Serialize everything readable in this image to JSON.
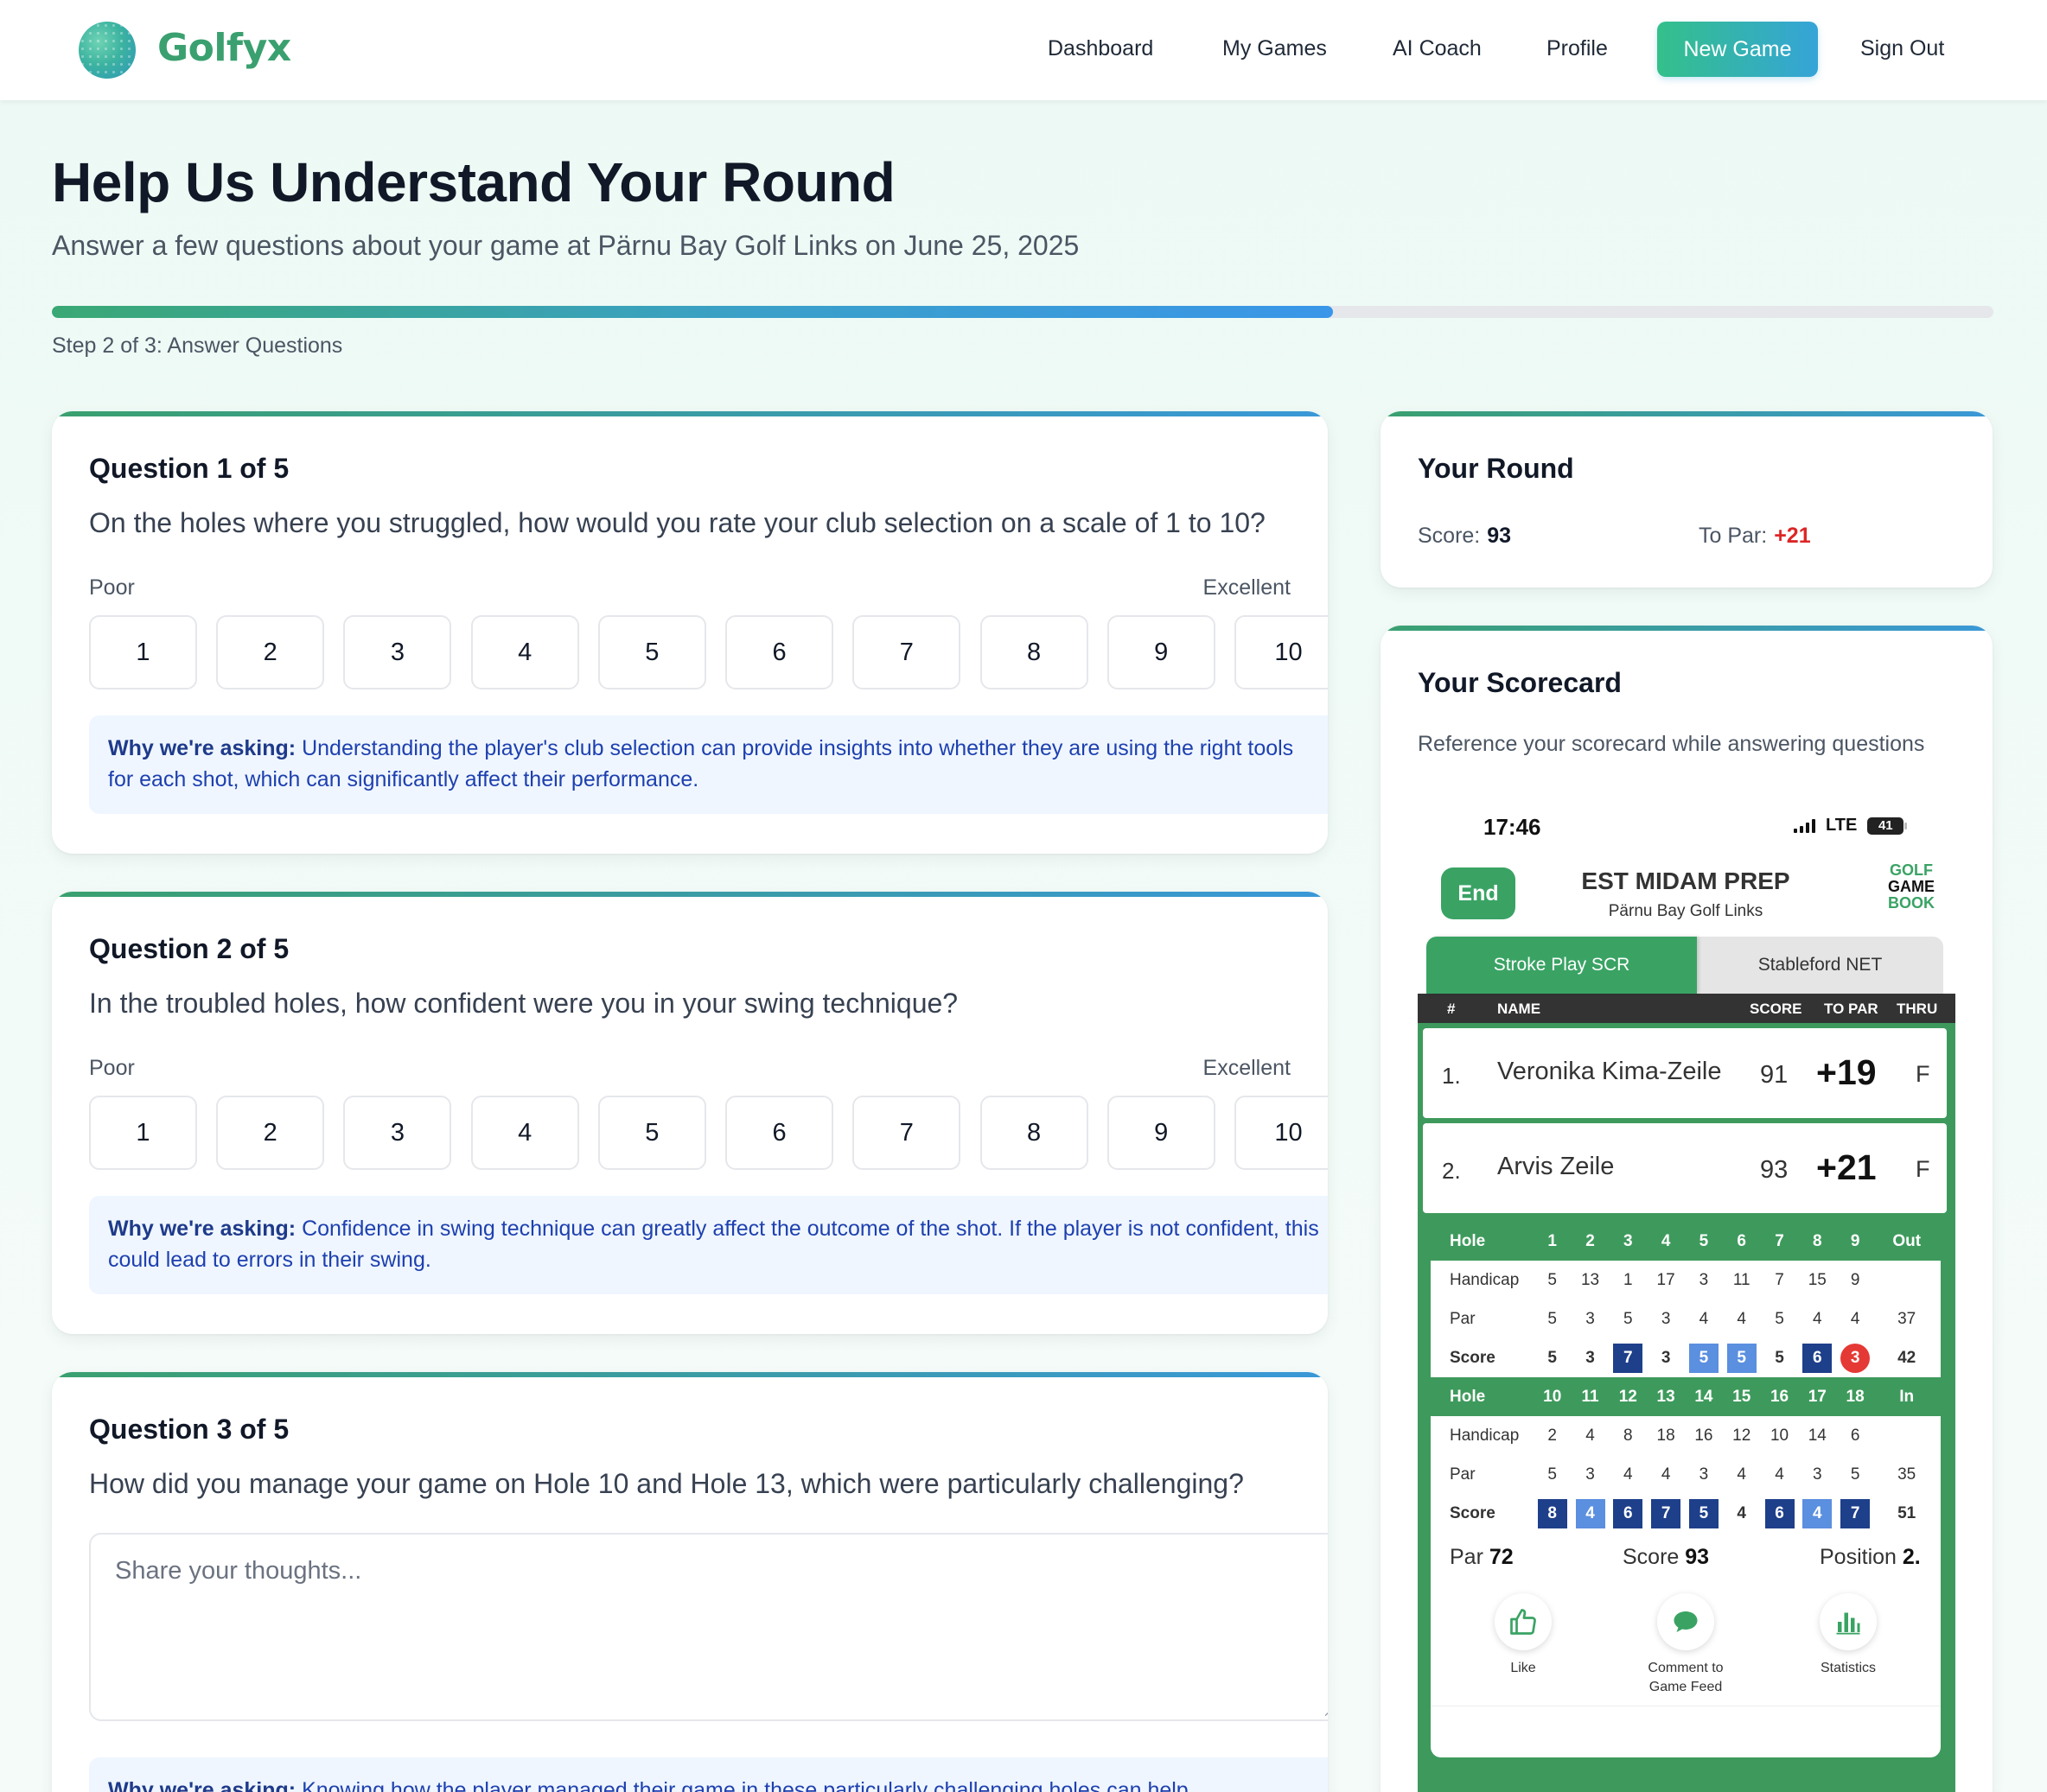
{
  "header": {
    "brand": "Golfyx",
    "nav": [
      "Dashboard",
      "My Games",
      "AI Coach",
      "Profile"
    ],
    "new_game": "New Game",
    "sign_out": "Sign Out"
  },
  "page": {
    "title": "Help Us Understand Your Round",
    "subtitle": "Answer a few questions about your game at Pärnu Bay Golf Links on June 25, 2025",
    "progress_fraction": 0.66,
    "step_label": "Step 2 of 3: Answer Questions"
  },
  "questions": [
    {
      "title": "Question 1 of 5",
      "text": "On the holes where you struggled, how would you rate your club selection on a scale of 1 to 10?",
      "low": "Poor",
      "high": "Excellent",
      "options": [
        "1",
        "2",
        "3",
        "4",
        "5",
        "6",
        "7",
        "8",
        "9",
        "10"
      ],
      "why_label": "Why we're asking:",
      "why_text": "Understanding the player's club selection can provide insights into whether they are using the right tools for each shot, which can significantly affect their performance."
    },
    {
      "title": "Question 2 of 5",
      "text": "In the troubled holes, how confident were you in your swing technique?",
      "low": "Poor",
      "high": "Excellent",
      "options": [
        "1",
        "2",
        "3",
        "4",
        "5",
        "6",
        "7",
        "8",
        "9",
        "10"
      ],
      "why_label": "Why we're asking:",
      "why_text": "Confidence in swing technique can greatly affect the outcome of the shot. If the player is not confident, this could lead to errors in their swing."
    },
    {
      "title": "Question 3 of 5",
      "text": "How did you manage your game on Hole 10 and Hole 13, which were particularly challenging?",
      "placeholder": "Share your thoughts...",
      "why_label": "Why we're asking:",
      "why_text": "Knowing how the player managed their game in these particularly challenging holes can help"
    }
  ],
  "round": {
    "title": "Your Round",
    "score_label": "Score:",
    "score": "93",
    "to_par_label": "To Par:",
    "to_par": "+21",
    "to_par_color": "#dc2626"
  },
  "scorecard": {
    "title": "Your Scorecard",
    "desc": "Reference your scorecard while answering questions",
    "status_time": "17:46",
    "status_network": "LTE",
    "battery": "41",
    "end_button": "End",
    "event_title": "EST MIDAM PREP",
    "event_course": "Pärnu Bay Golf Links",
    "logo_lines": [
      "GOLF",
      "GAME",
      "BOOK"
    ],
    "tabs": [
      "Stroke Play SCR",
      "Stableford NET"
    ],
    "columns": [
      "#",
      "NAME",
      "SCORE",
      "TO PAR",
      "THRU"
    ],
    "players": [
      {
        "pos": "1.",
        "name": "Veronika Kima-Zeile",
        "score": "91",
        "to_par": "+19",
        "thru": "F"
      },
      {
        "pos": "2.",
        "name": "Arvis Zeile",
        "score": "93",
        "to_par": "+21",
        "thru": "F"
      }
    ],
    "front": {
      "hole_label": "Hole",
      "holes": [
        "1",
        "2",
        "3",
        "4",
        "5",
        "6",
        "7",
        "8",
        "9"
      ],
      "total_label": "Out",
      "handicap_label": "Handicap",
      "handicap": [
        "5",
        "13",
        "1",
        "17",
        "3",
        "11",
        "7",
        "15",
        "9"
      ],
      "par_label": "Par",
      "par": [
        "5",
        "3",
        "5",
        "3",
        "4",
        "4",
        "5",
        "4",
        "4"
      ],
      "par_total": "37",
      "score_label": "Score",
      "score": [
        "5",
        "3",
        "7",
        "3",
        "5",
        "5",
        "5",
        "6",
        "3"
      ],
      "score_style": [
        "",
        "",
        "dark",
        "",
        "light",
        "light",
        "",
        "dark",
        "red"
      ],
      "score_total": "42"
    },
    "back": {
      "hole_label": "Hole",
      "holes": [
        "10",
        "11",
        "12",
        "13",
        "14",
        "15",
        "16",
        "17",
        "18"
      ],
      "total_label": "In",
      "handicap_label": "Handicap",
      "handicap": [
        "2",
        "4",
        "8",
        "18",
        "16",
        "12",
        "10",
        "14",
        "6"
      ],
      "par_label": "Par",
      "par": [
        "5",
        "3",
        "4",
        "4",
        "3",
        "4",
        "4",
        "3",
        "5"
      ],
      "par_total": "35",
      "score_label": "Score",
      "score": [
        "8",
        "4",
        "6",
        "7",
        "5",
        "4",
        "6",
        "4",
        "7"
      ],
      "score_style": [
        "dark",
        "light",
        "dark",
        "dark",
        "dark",
        "",
        "dark",
        "light",
        "dark"
      ],
      "score_total": "51"
    },
    "summary": {
      "par_label": "Par",
      "par": "72",
      "score_label": "Score",
      "score": "93",
      "position_label": "Position",
      "position": "2."
    },
    "actions": [
      "Like",
      "Comment to Game Feed",
      "Statistics"
    ],
    "colors": {
      "green": "#3aa364",
      "dark_blue": "#1e3f8a",
      "light_blue": "#5b8fdf",
      "red": "#e53935"
    }
  }
}
